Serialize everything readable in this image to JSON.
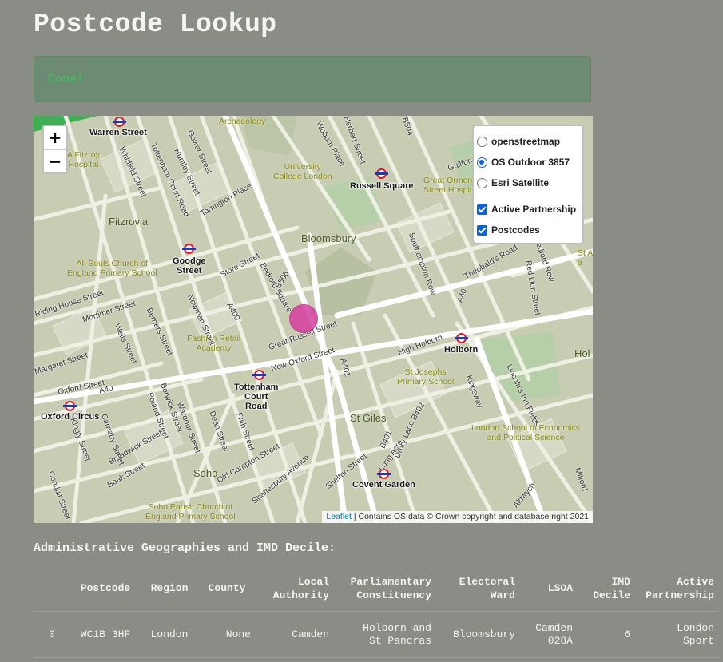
{
  "page": {
    "title": "Postcode Lookup"
  },
  "alert": {
    "text": "Done!"
  },
  "map": {
    "zoom_in_label": "+",
    "zoom_out_label": "−",
    "layers": {
      "base": [
        {
          "label": "openstreetmap",
          "selected": false
        },
        {
          "label": "OS Outdoor 3857",
          "selected": true
        },
        {
          "label": "Esri Satellite",
          "selected": false
        }
      ],
      "overlays": [
        {
          "label": "Active Partnership",
          "checked": true
        },
        {
          "label": "Postcodes",
          "checked": true
        }
      ]
    },
    "attribution": {
      "link": "Leaflet",
      "text": " | Contains OS data © Crown copyright and database right 2021"
    },
    "labels": {
      "stations": [
        "Warren Street",
        "Russell Square",
        "Goodge\nStreet",
        "Holborn",
        "Tottenham\nCourt\nRoad",
        "Oxford Circus",
        "Covent Garden"
      ],
      "areas": [
        "Fitzrovia",
        "Bloomsbury",
        "St Giles",
        "Soho",
        "Hol"
      ],
      "pois": [
        "Archaeology",
        "University\nCollege London",
        "Great Ormond\nStreet Hospit",
        "A Fitzroy\nHospital",
        "All Souls Church of\nEngland Primary School",
        "Fashion Retail\nAcademy",
        "St Josephs\nPrimary School",
        "London School of Economics\nand Political Science",
        "Soho Parish Church of\nEngland Primary School",
        "St A\na"
      ],
      "roads": [
        "Tottenham Court Road",
        "Gower Street",
        "Whitfield Street",
        "Huntley Street",
        "Torrington Place",
        "Woburn Place",
        "Herbert Street",
        "B504",
        "Guilford",
        "Store Street",
        "Bedford Square",
        "B506",
        "A400",
        "Great Russell Street",
        "New Oxford Street",
        "High Holborn",
        "Southampton Row",
        "A40",
        "Theobald's Road",
        "Red Lion Street",
        "Bedford Row",
        "Kingsway",
        "Lincoln's Inn Fields",
        "Drury Lane",
        "B402",
        "Long Acre",
        "Shelton Street",
        "Shaftesbury Avenue",
        "Old Compton Street",
        "Frith Street",
        "Dean Street",
        "Wardour Street",
        "Berwick Street",
        "Poland Street",
        "Broadwick Street",
        "Carnaby Street",
        "Kingly Street",
        "Beak Street",
        "Newman Street",
        "Berners Street",
        "Wells Street",
        "Mortimer Street",
        "Riding House Street",
        "Margaret Street",
        "A40",
        "Oxford Street",
        "Conduit Street",
        "Aldwych",
        "Milford",
        "A401",
        "B401"
      ]
    }
  },
  "table": {
    "section_title": "Administrative Geographies and IMD Decile:",
    "headers": [
      "",
      "Postcode",
      "Region",
      "County",
      "Local\nAuthority",
      "Parliamentary\nConstituency",
      "Electoral\nWard",
      "LSOA",
      "IMD\nDecile",
      "Active\nPartnership"
    ],
    "rows": [
      [
        "0",
        "WC1B 3HF",
        "London",
        "None",
        "Camden",
        "Holborn and\nSt Pancras",
        "Bloomsbury",
        "Camden\n028A",
        "6",
        "London\nSport"
      ]
    ]
  }
}
